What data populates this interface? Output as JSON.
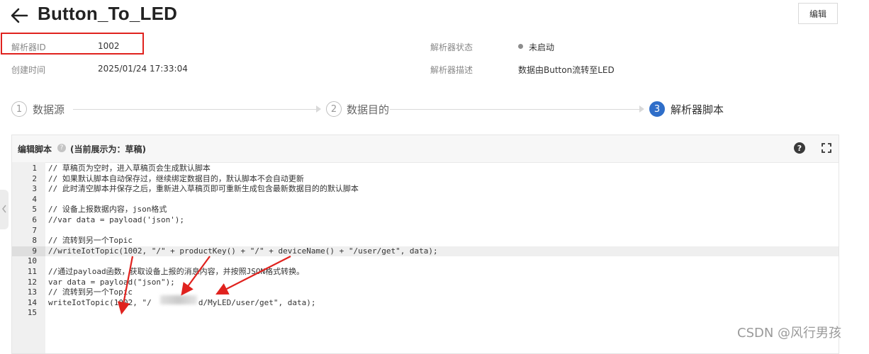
{
  "header": {
    "title": "Button_To_LED",
    "edit_label": "编辑"
  },
  "info": {
    "parser_id_label": "解析器ID",
    "parser_id_value": "1002",
    "created_label": "创建时间",
    "created_value": "2025/01/24 17:33:04",
    "status_label": "解析器状态",
    "status_value": "未启动",
    "desc_label": "解析器描述",
    "desc_value": "数据由Button流转至LED"
  },
  "steps": [
    {
      "num": "1",
      "label": "数据源",
      "active": false
    },
    {
      "num": "2",
      "label": "数据目的",
      "active": false
    },
    {
      "num": "3",
      "label": "解析器脚本",
      "active": true
    }
  ],
  "editor": {
    "title": "编辑脚本",
    "hint_icon": "?",
    "note": "(当前展示为：草稿)",
    "help_icon": "?",
    "active_line": 9,
    "lines": [
      {
        "n": "1",
        "code": "// 草稿页为空时，进入草稿页会生成默认脚本"
      },
      {
        "n": "2",
        "code": "// 如果默认脚本自动保存过，继续绑定数据目的，默认脚本不会自动更新"
      },
      {
        "n": "3",
        "code": "// 此时清空脚本并保存之后，重新进入草稿页即可重新生成包含最新数据目的的默认脚本"
      },
      {
        "n": "4",
        "code": ""
      },
      {
        "n": "5",
        "code": "// 设备上报数据内容，json格式"
      },
      {
        "n": "6",
        "code": "//var data = payload('json');"
      },
      {
        "n": "7",
        "code": ""
      },
      {
        "n": "8",
        "code": "// 流转到另一个Topic"
      },
      {
        "n": "9",
        "code": "//writeIotTopic(1002, \"/\" + productKey() + \"/\" + deviceName() + \"/user/get\", data);"
      },
      {
        "n": "10",
        "code": ""
      },
      {
        "n": "11",
        "code": "//通过payload函数，获取设备上报的消息内容，并按照JSON格式转换。"
      },
      {
        "n": "12",
        "code": "var data = payload(\"json\");"
      },
      {
        "n": "13",
        "code": "// 流转到另一个Topic"
      },
      {
        "n": "14",
        "code": "writeIotTopic(1002, \"/          d/MyLED/user/get\", data);"
      },
      {
        "n": "15",
        "code": ""
      }
    ]
  },
  "watermark": "CSDN @风行男孩",
  "colors": {
    "accent": "#2f6ec9",
    "highlight_red": "#e0221e",
    "status_gray": "#8c8c8c"
  }
}
